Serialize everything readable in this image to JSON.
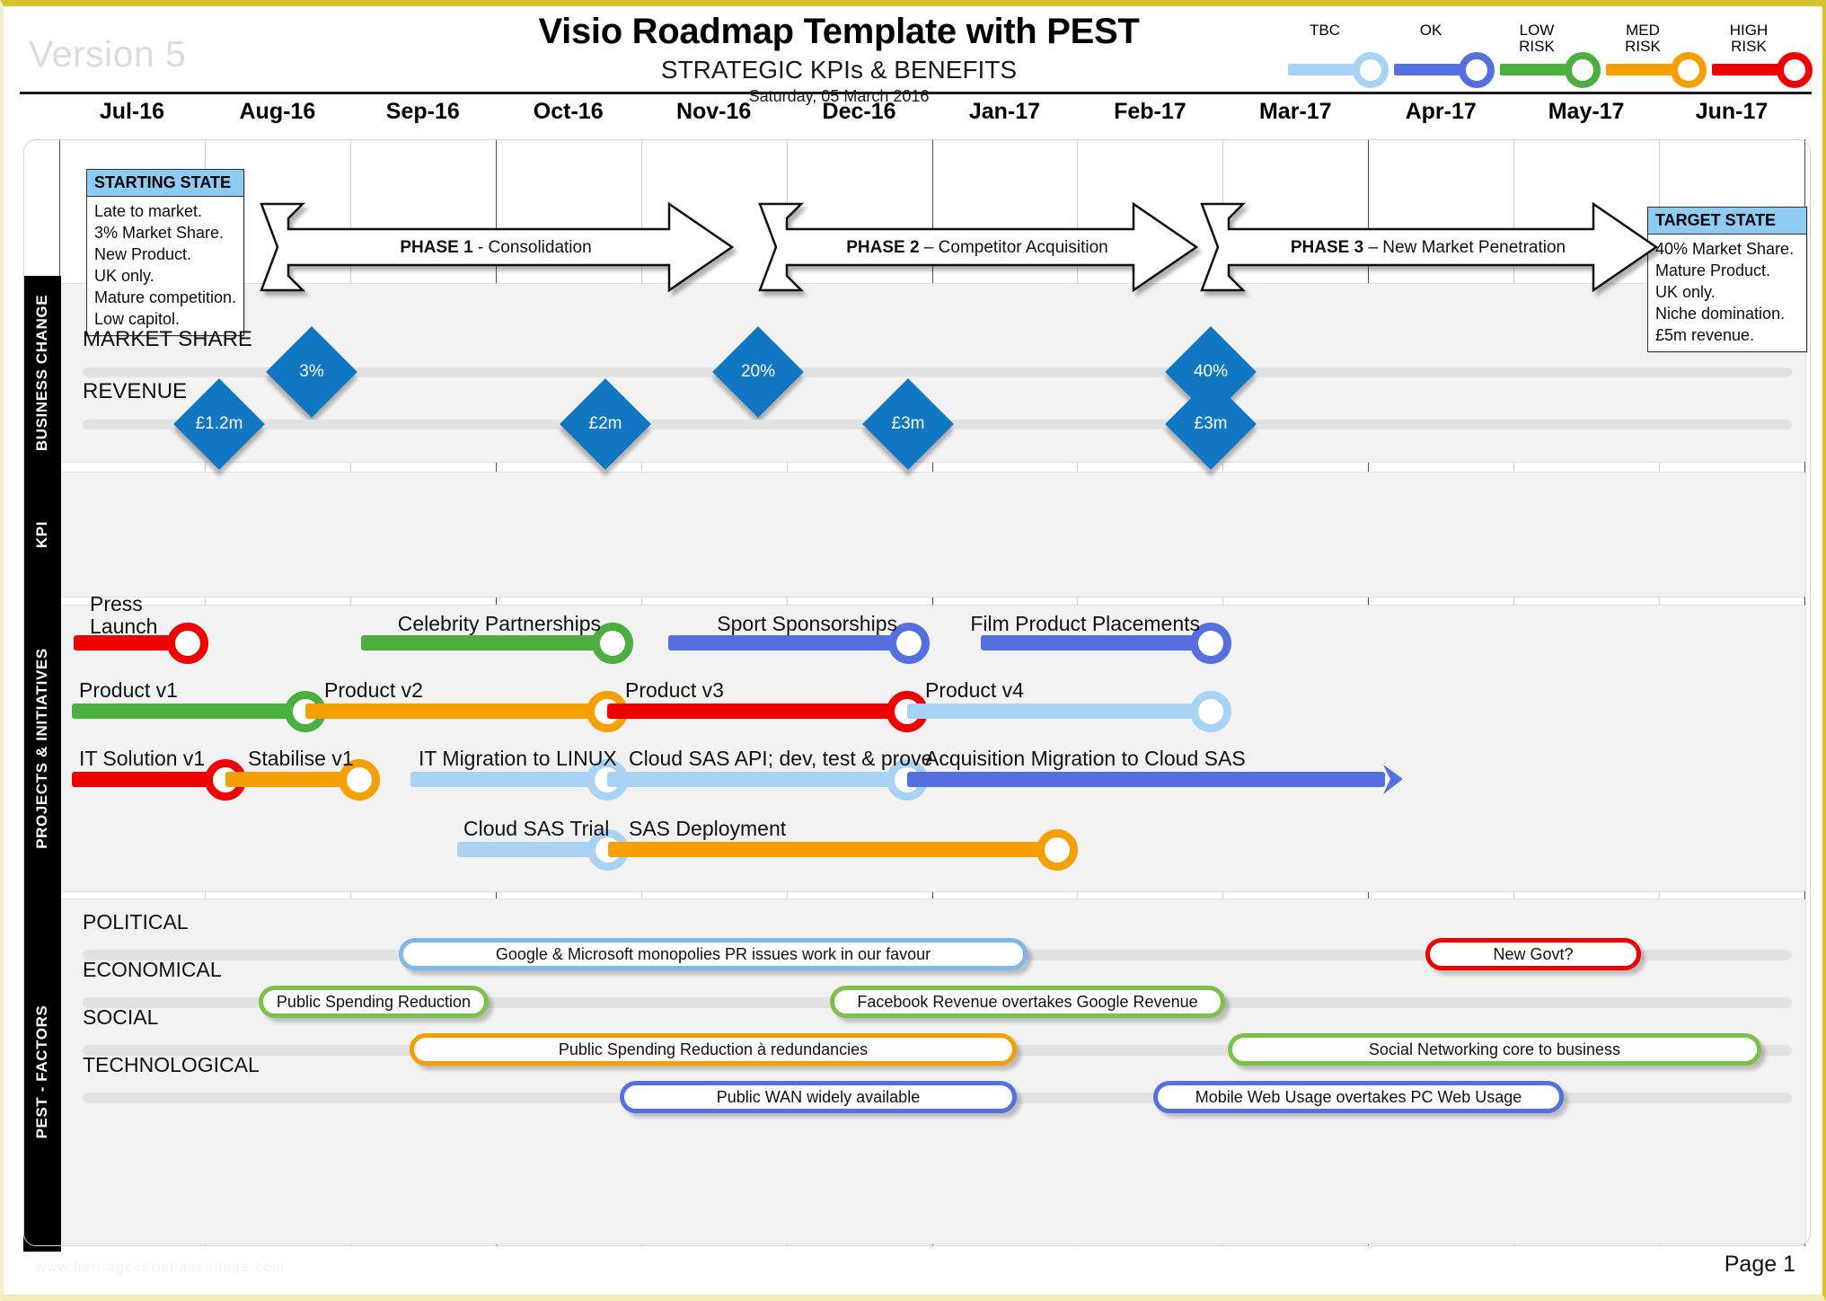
{
  "header": {
    "version": "Version 5",
    "title": "Visio Roadmap Template with PEST",
    "subtitle": "STRATEGIC KPIs & BENEFITS",
    "date": "Saturday, 05 March 2016"
  },
  "legend": {
    "items": [
      {
        "label": "TBC",
        "color": "#a8d3f5"
      },
      {
        "label": "OK",
        "color": "#5570de"
      },
      {
        "label": "LOW\nRISK",
        "color": "#4aaf3e"
      },
      {
        "label": "MED\nRISK",
        "color": "#f5a000"
      },
      {
        "label": "HIGH\nRISK",
        "color": "#ee0000"
      }
    ]
  },
  "timeline": {
    "months": [
      "Jul-16",
      "Aug-16",
      "Sep-16",
      "Oct-16",
      "Nov-16",
      "Dec-16",
      "Jan-17",
      "Feb-17",
      "Mar-17",
      "Apr-17",
      "May-17",
      "Jun-17"
    ]
  },
  "sections": {
    "business_change": {
      "label": "BUSINESS CHANGE"
    },
    "kpi": {
      "label": "KPI"
    },
    "projects": {
      "label": "PROJECTS & INITIATIVES"
    },
    "pest": {
      "label": "PEST - FACTORS"
    }
  },
  "business_change": {
    "starting_state": {
      "heading": "STARTING STATE",
      "lines": [
        "Late to market.",
        "3% Market Share.",
        "New Product.",
        "UK only.",
        "Mature competition.",
        "Low capitol."
      ]
    },
    "target_state": {
      "heading": "TARGET STATE",
      "lines": [
        "40% Market Share.",
        "Mature Product.",
        "UK only.",
        "Niche domination.",
        "£5m revenue."
      ]
    },
    "phases": [
      {
        "bold": "PHASE 1",
        "rest": " - Consolidation"
      },
      {
        "bold": "PHASE 2",
        "rest": " – Competitor Acquisition"
      },
      {
        "bold": "PHASE 3",
        "rest": " – New Market Penetration"
      }
    ]
  },
  "kpi": {
    "rows": [
      {
        "label": "MARKET SHARE",
        "markers": [
          {
            "value": "3%"
          },
          {
            "value": "20%"
          },
          {
            "value": "40%"
          }
        ]
      },
      {
        "label": "REVENUE",
        "markers": [
          {
            "value": "£1.2m"
          },
          {
            "value": "£2m"
          },
          {
            "value": "£3m"
          },
          {
            "value": "£3m"
          }
        ]
      }
    ]
  },
  "projects": {
    "rows": [
      {
        "items": [
          {
            "label": "Press\nLaunch",
            "color": "#ee0000"
          },
          {
            "label": "Celebrity Partnerships",
            "color": "#4aaf3e"
          },
          {
            "label": "Sport Sponsorships",
            "color": "#5570de"
          },
          {
            "label": "Film Product Placements",
            "color": "#5570de"
          }
        ]
      },
      {
        "items": [
          {
            "label": "Product v1",
            "color": "#4aaf3e"
          },
          {
            "label": "Product v2",
            "color": "#f5a000"
          },
          {
            "label": "Product v3",
            "color": "#ee0000"
          },
          {
            "label": "Product v4",
            "color": "#a8d3f5"
          }
        ]
      },
      {
        "items": [
          {
            "label": "IT Solution v1",
            "color": "#ee0000"
          },
          {
            "label": "Stabilise v1",
            "color": "#f5a000"
          },
          {
            "label": "IT Migration to LINUX",
            "color": "#a8d3f5"
          },
          {
            "label": "Cloud SAS API; dev, test & prove",
            "color": "#a8d3f5"
          },
          {
            "label": "Acquisition Migration to Cloud SAS",
            "color": "#5570de"
          }
        ]
      },
      {
        "items": [
          {
            "label": "Cloud SAS Trial",
            "color": "#a8d3f5"
          },
          {
            "label": "SAS Deployment",
            "color": "#f5a000"
          }
        ]
      }
    ]
  },
  "pest": {
    "rows": [
      {
        "label": "POLITICAL",
        "pills": [
          {
            "text": "Google & Microsoft monopolies PR issues work in our favour",
            "color": "#7fb7e8"
          },
          {
            "text": "New Govt?",
            "color": "#ee0000"
          }
        ]
      },
      {
        "label": "ECONOMICAL",
        "pills": [
          {
            "text": "Public Spending Reduction",
            "color": "#7cc24a"
          },
          {
            "text": "Facebook Revenue overtakes Google Revenue",
            "color": "#7cc24a"
          }
        ]
      },
      {
        "label": "SOCIAL",
        "pills": [
          {
            "text": "Public Spending Reduction à redundancies",
            "color": "#f5a000"
          },
          {
            "text": "Social Networking core to business",
            "color": "#7cc24a"
          }
        ]
      },
      {
        "label": "TECHNOLOGICAL",
        "pills": [
          {
            "text": "Public WAN widely available",
            "color": "#5570de"
          },
          {
            "text": "Mobile Web Usage overtakes PC Web Usage",
            "color": "#5570de"
          }
        ]
      }
    ]
  },
  "footer": {
    "watermark": "www.heritagechristiancollege.com",
    "page": "Page 1"
  }
}
